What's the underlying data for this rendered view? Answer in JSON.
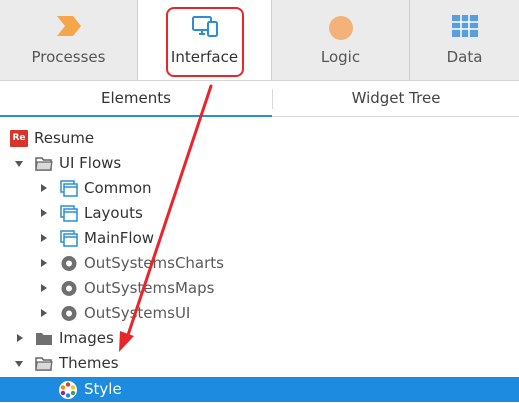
{
  "top_tabs": [
    {
      "label": "Processes",
      "icon": "processes-chevron-icon",
      "color": "#f5a64a"
    },
    {
      "label": "Interface",
      "icon": "monitor-device-icon",
      "color": "#2a8ed8"
    },
    {
      "label": "Logic",
      "icon": "logic-circle-icon",
      "color": "#f3b27a"
    },
    {
      "label": "Data",
      "icon": "data-grid-icon",
      "color": "#5a9ee0"
    }
  ],
  "sub_tabs": [
    {
      "label": "Elements"
    },
    {
      "label": "Widget Tree"
    }
  ],
  "tree": {
    "resume": {
      "label": "Resume",
      "badge": "Re"
    },
    "ui_flows": {
      "label": "UI Flows"
    },
    "common": {
      "label": "Common"
    },
    "layouts": {
      "label": "Layouts"
    },
    "mainflow": {
      "label": "MainFlow"
    },
    "outsystems_charts": {
      "label": "OutSystemsCharts"
    },
    "outsystems_maps": {
      "label": "OutSystemsMaps"
    },
    "outsystems_ui": {
      "label": "OutSystemsUI"
    },
    "images": {
      "label": "Images"
    },
    "themes": {
      "label": "Themes"
    },
    "style": {
      "label": "Style"
    }
  },
  "colors": {
    "accent": "#2a8ed8",
    "highlight": "#e8262a",
    "selected_row": "#1c8be0"
  }
}
